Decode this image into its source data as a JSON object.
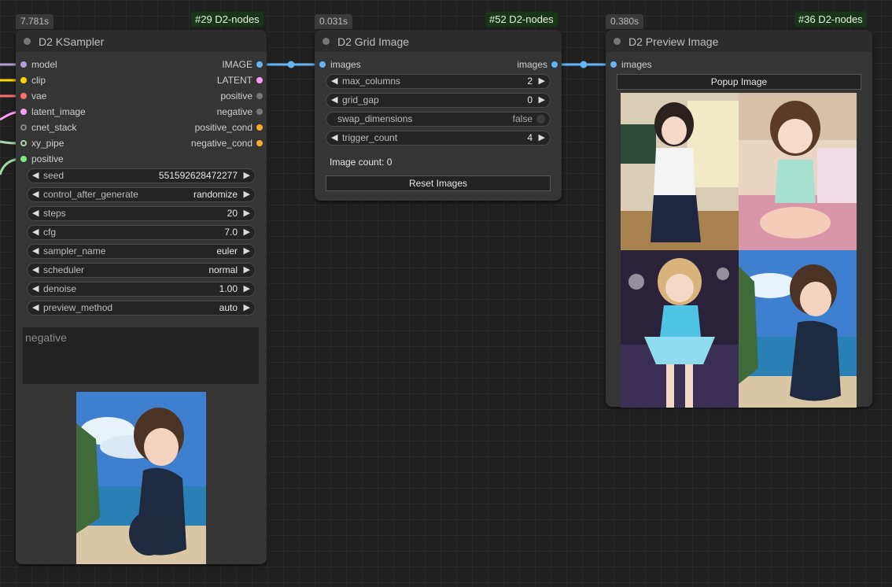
{
  "nodes": {
    "ksampler": {
      "time": "7.781s",
      "id": "#29 D2-nodes",
      "title": "D2 KSampler",
      "inputs": [
        "model",
        "clip",
        "vae",
        "latent_image",
        "cnet_stack",
        "xy_pipe",
        "positive"
      ],
      "outputs": [
        "IMAGE",
        "LATENT",
        "positive",
        "negative",
        "positive_cond",
        "negative_cond"
      ],
      "widgets": [
        {
          "label": "seed",
          "value": "551592628472277"
        },
        {
          "label": "control_after_generate",
          "value": "randomize"
        },
        {
          "label": "steps",
          "value": "20"
        },
        {
          "label": "cfg",
          "value": "7.0"
        },
        {
          "label": "sampler_name",
          "value": "euler"
        },
        {
          "label": "scheduler",
          "value": "normal"
        },
        {
          "label": "denoise",
          "value": "1.00"
        },
        {
          "label": "preview_method",
          "value": "auto"
        }
      ],
      "negative_placeholder": "negative",
      "preview_image": "anime girl in dark swimsuit at beach"
    },
    "grid": {
      "time": "0.031s",
      "id": "#52 D2-nodes",
      "title": "D2 Grid Image",
      "input": "images",
      "output": "images",
      "widgets": [
        {
          "label": "max_columns",
          "value": "2"
        },
        {
          "label": "grid_gap",
          "value": "0"
        }
      ],
      "toggle": {
        "label": "swap_dimensions",
        "value": "false"
      },
      "widgets2": [
        {
          "label": "trigger_count",
          "value": "4"
        }
      ],
      "image_count": "Image count: 0",
      "reset_button": "Reset Images"
    },
    "preview": {
      "time": "0.380s",
      "id": "#36 D2-nodes",
      "title": "D2 Preview Image",
      "input": "images",
      "popup_button": "Popup Image",
      "images": [
        "classroom schoolgirl",
        "bedroom girl",
        "idol on stage",
        "girl in swimsuit at beach"
      ]
    }
  },
  "colors": {
    "model": "#b39ddb",
    "clip": "#ffd500",
    "vae": "#ff6e6e",
    "latent": "#ff9cf9",
    "cnet": "#888888",
    "xy_pipe": "#a5d6a7",
    "positive": "#7dea7d",
    "image": "#64b5f6",
    "cond": "#ffa931",
    "negative": "#777777",
    "link": "#64b5f6"
  },
  "icons": {
    "left": "◀",
    "right": "▶"
  }
}
